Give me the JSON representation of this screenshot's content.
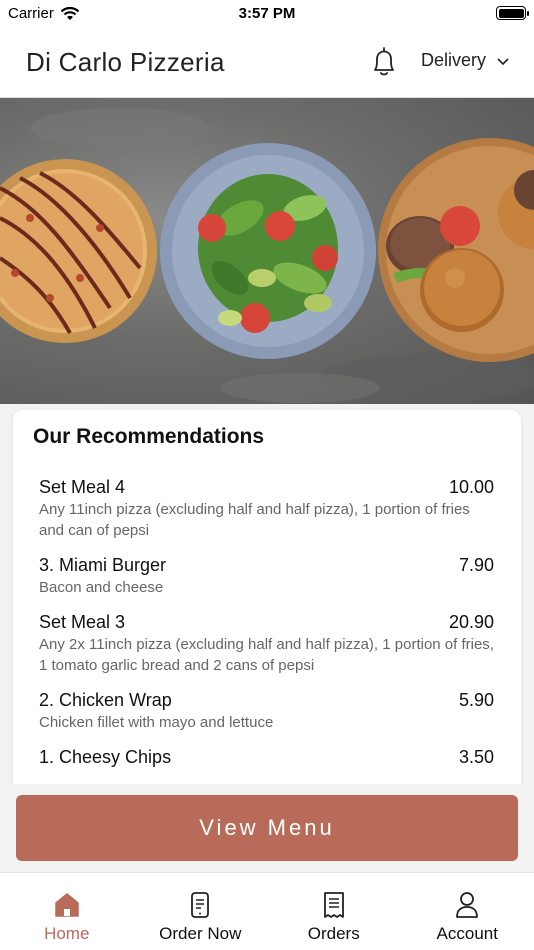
{
  "status_bar": {
    "carrier": "Carrier",
    "time": "3:57 PM"
  },
  "header": {
    "title": "Di Carlo Pizzeria",
    "delivery_label": "Delivery"
  },
  "recommendations": {
    "title": "Our Recommendations",
    "items": [
      {
        "name": "Set Meal 4",
        "price": "10.00",
        "description": "Any 11inch pizza (excluding half and half pizza), 1 portion of fries and can of pepsi"
      },
      {
        "name": "3. Miami Burger",
        "price": "7.90",
        "description": "Bacon and cheese"
      },
      {
        "name": "Set Meal 3",
        "price": "20.90",
        "description": "Any 2x 11inch pizza (excluding half and half pizza), 1 portion of fries, 1 tomato garlic bread and 2 cans of pepsi"
      },
      {
        "name": "2. Chicken Wrap",
        "price": "5.90",
        "description": "Chicken fillet with mayo and lettuce"
      },
      {
        "name": "1. Cheesy Chips",
        "price": "3.50",
        "description": ""
      }
    ]
  },
  "view_menu_label": "View Menu",
  "tabs": [
    {
      "label": "Home",
      "icon": "home-icon",
      "active": true
    },
    {
      "label": "Order Now",
      "icon": "phone-order-icon",
      "active": false
    },
    {
      "label": "Orders",
      "icon": "receipt-icon",
      "active": false
    },
    {
      "label": "Account",
      "icon": "user-icon",
      "active": false
    }
  ],
  "colors": {
    "accent": "#b76b58",
    "background": "#f2f2f2"
  }
}
